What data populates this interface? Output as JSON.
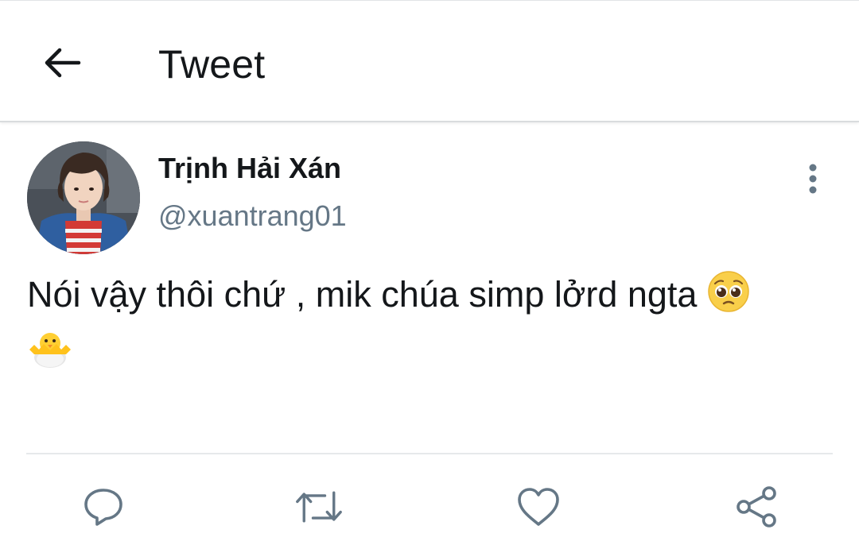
{
  "header": {
    "back_icon": "arrow-left-icon",
    "title": "Tweet"
  },
  "tweet": {
    "user": {
      "name": "Trịnh Hải Xán",
      "handle": "@xuantrang01"
    },
    "text": "Nói vậy thôi chứ , mik chúa simp lởrd ngta",
    "emojis": [
      "pleading-face-emoji",
      "hatching-chick-emoji"
    ],
    "more_icon": "more-vertical-icon"
  },
  "actions": {
    "reply_icon": "reply-icon",
    "retweet_icon": "retweet-icon",
    "like_icon": "heart-icon",
    "share_icon": "share-icon"
  },
  "colors": {
    "text_primary": "#14171a",
    "text_secondary": "#657786",
    "icon_gray": "#657786",
    "divider": "#e6e9eb"
  }
}
